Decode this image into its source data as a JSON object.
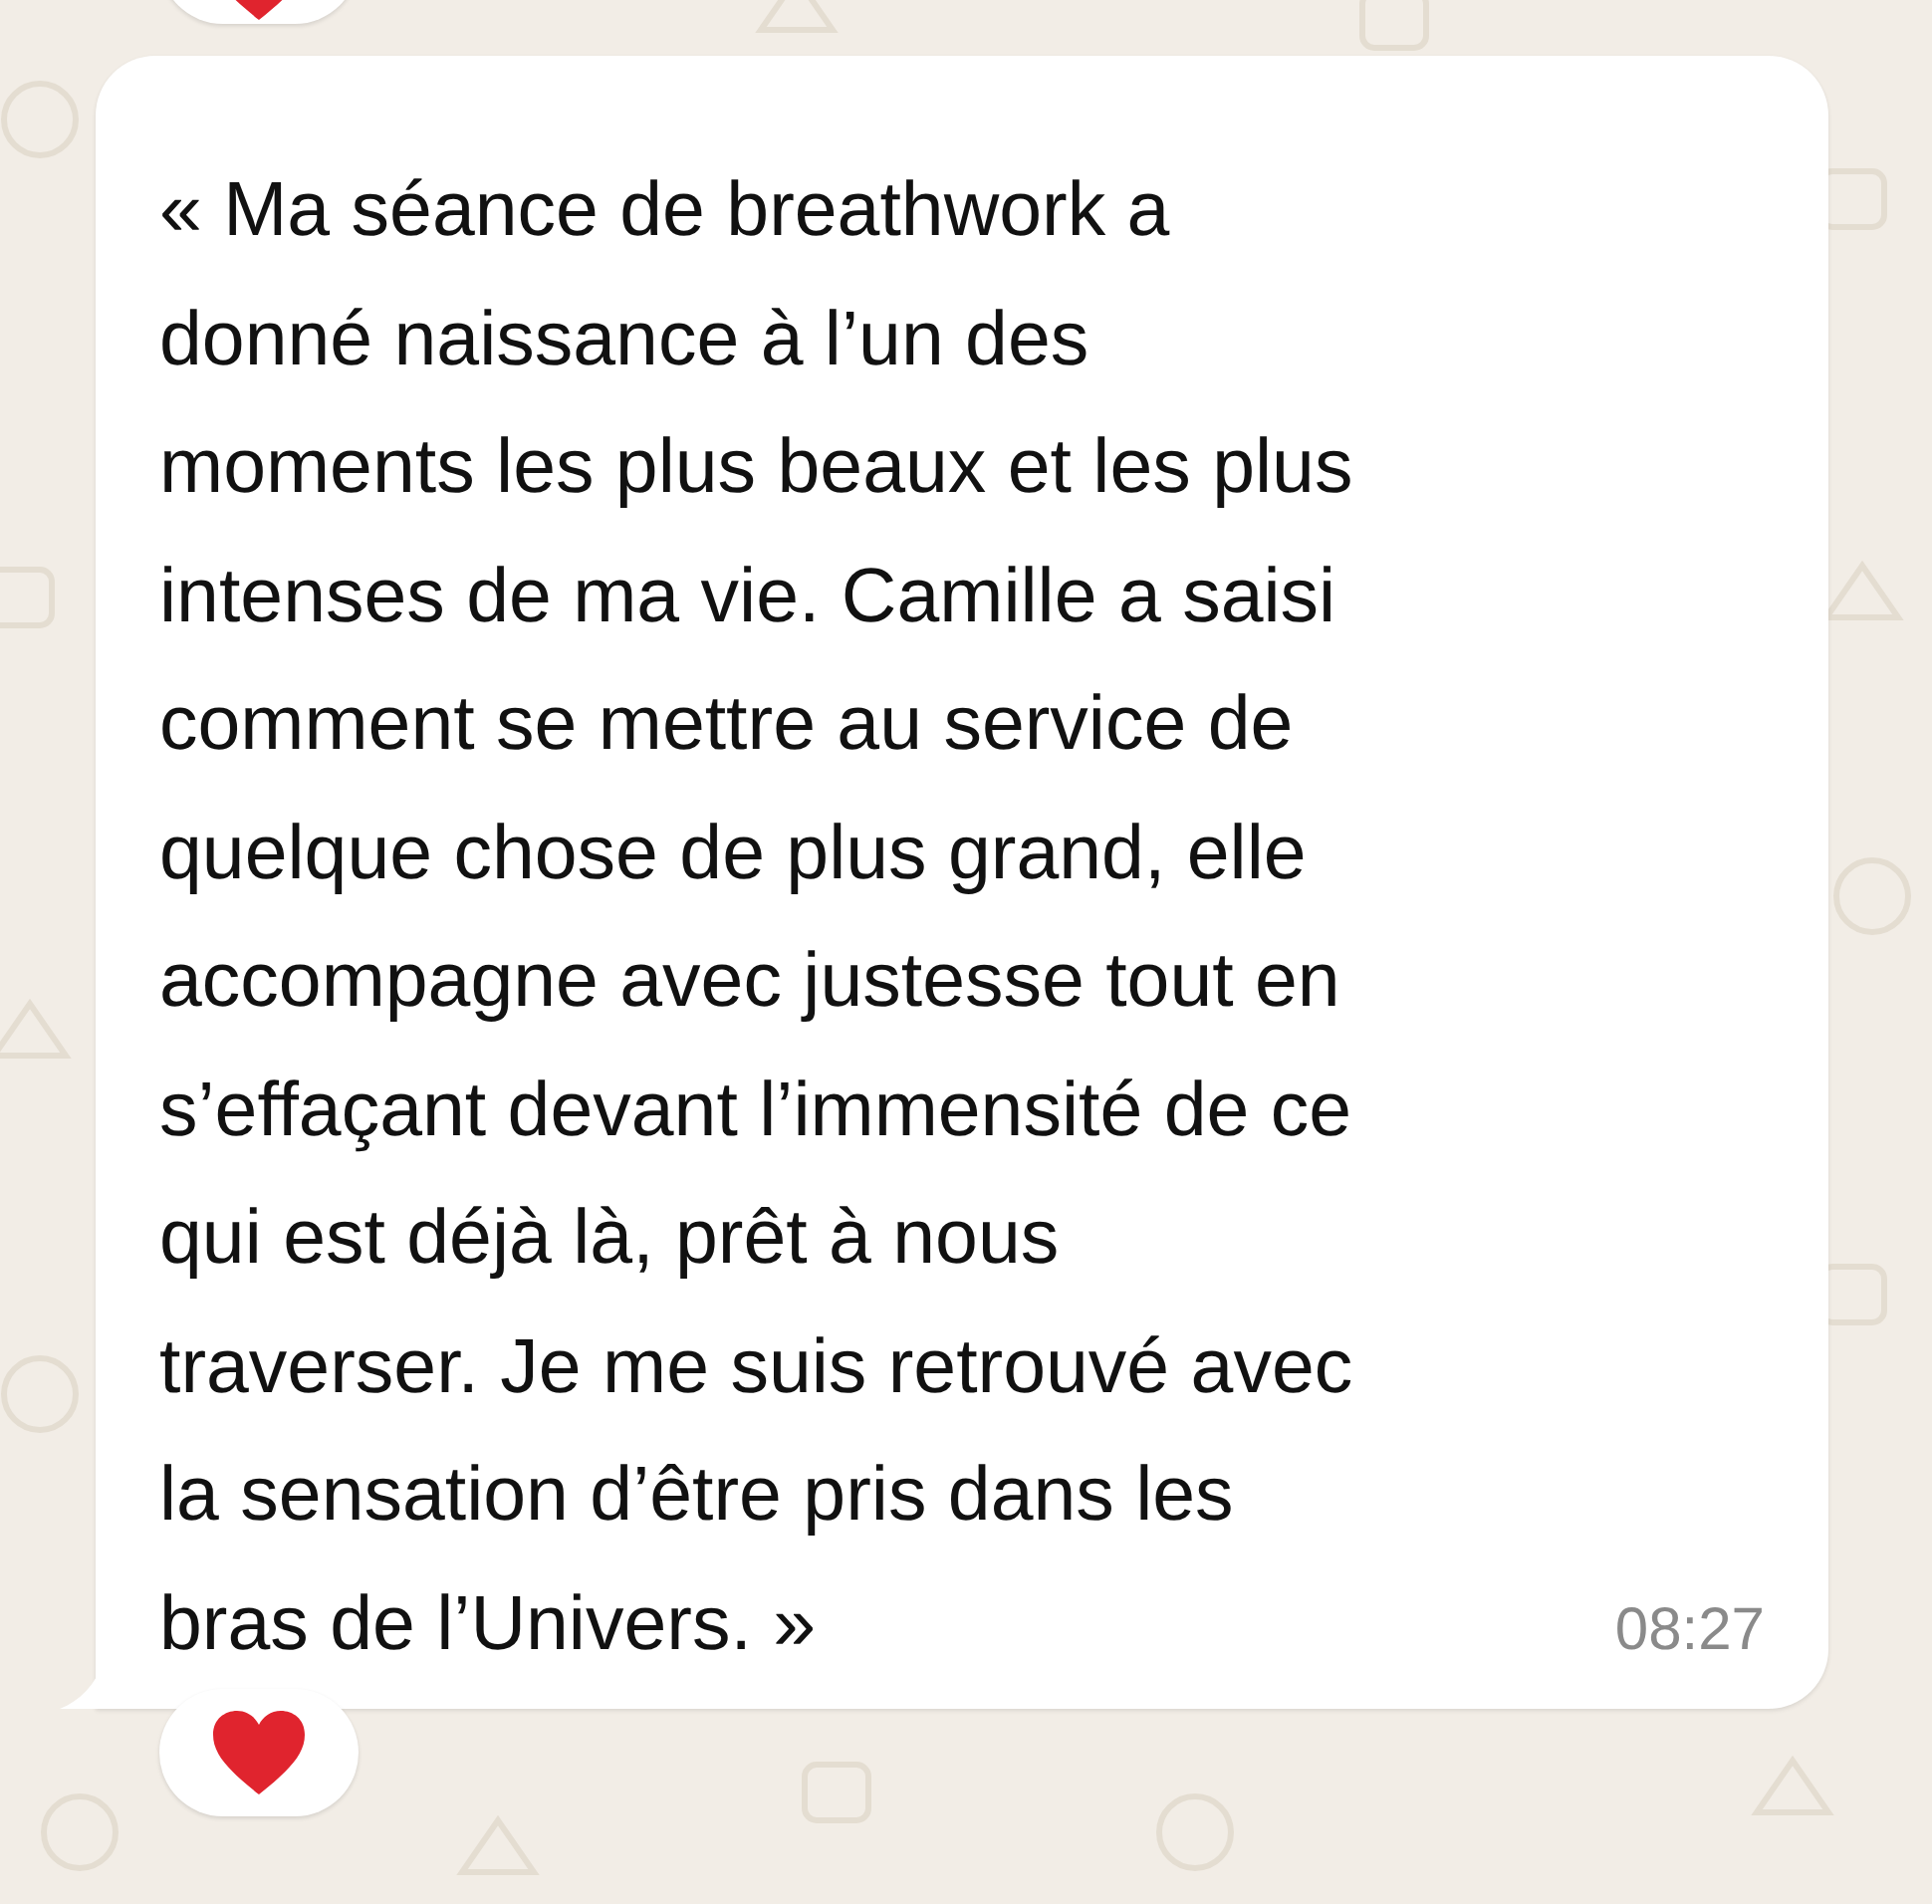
{
  "previous_message": {
    "reaction": {
      "kind": "heart"
    }
  },
  "message": {
    "lines": [
      "« Ma séance de breathwork a",
      "donné naissance à l’un des",
      "moments les plus beaux et les plus",
      "intenses de ma vie. Camille a saisi",
      "comment se mettre au service de",
      "quelque chose de plus grand, elle",
      "accompagne avec justesse tout en",
      "s’effaçant devant l’immensité de ce",
      "qui est déjà là, prêt à nous",
      "traverser. Je me suis retrouvé avec",
      "la sensation d’être pris dans les",
      "bras de l’Univers. »"
    ],
    "time": "08:27",
    "reaction": {
      "kind": "heart"
    }
  }
}
